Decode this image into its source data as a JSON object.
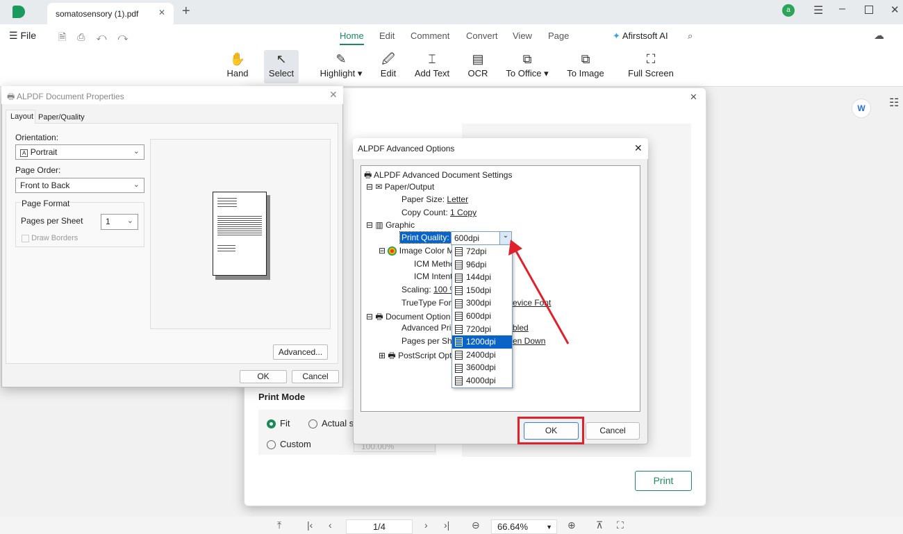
{
  "app": {
    "tab_title": "somatosensory (1).pdf",
    "user_initial": "a",
    "accent": "#1a8a5c"
  },
  "menu": {
    "file": "File",
    "tabs": [
      "Home",
      "Edit",
      "Comment",
      "Convert",
      "View",
      "Page"
    ],
    "ai": "Afirstsoft AI"
  },
  "toolbar": [
    {
      "label": "Hand",
      "icon": "hand-icon"
    },
    {
      "label": "Select",
      "icon": "cursor-icon"
    },
    {
      "label": "Highlight",
      "icon": "highlighter-icon"
    },
    {
      "label": "Edit",
      "icon": "edit-icon"
    },
    {
      "label": "Add Text",
      "icon": "add-text-icon"
    },
    {
      "label": "OCR",
      "icon": "ocr-icon"
    },
    {
      "label": "To Office",
      "icon": "office-icon"
    },
    {
      "label": "To Image",
      "icon": "image-icon"
    },
    {
      "label": "Full Screen",
      "icon": "fullscreen-icon"
    }
  ],
  "props": {
    "title": "ALPDF Document Properties",
    "tabs": [
      "Layout",
      "Paper/Quality"
    ],
    "orientation_label": "Orientation:",
    "orientation": "Portrait",
    "page_order_label": "Page Order:",
    "page_order": "Front to Back",
    "page_format": "Page Format",
    "pps_label": "Pages per Sheet",
    "pps": "1",
    "draw_borders": "Draw Borders",
    "advanced": "Advanced...",
    "ok": "OK",
    "cancel": "Cancel"
  },
  "adv": {
    "title": "ALPDF Advanced Options",
    "root": "ALPDF Advanced Document Settings",
    "paper_output": "Paper/Output",
    "paper_size_label": "Paper Size:",
    "paper_size": "Letter",
    "copy_count_label": "Copy Count:",
    "copy_count": "1 Copy",
    "graphic": "Graphic",
    "print_quality_label": "Print Quality:",
    "print_quality": "600dpi",
    "image_color": "Image Color M",
    "icm_method": "ICM Metho",
    "icm_intent": "ICM Intent",
    "scaling_label": "Scaling:",
    "scaling": "100 %",
    "truetype": "TrueType Font",
    "truetype_value": "evice Font",
    "doc_options": "Document Option",
    "adv_print": "Advanced Prin",
    "adv_print_value": "bled",
    "pps": "Pages per Shee",
    "pps_value": "en Down",
    "postscript": "PostScript Opt",
    "options": [
      "72dpi",
      "96dpi",
      "144dpi",
      "150dpi",
      "300dpi",
      "600dpi",
      "720dpi",
      "1200dpi",
      "2400dpi",
      "3600dpi",
      "4000dpi"
    ],
    "highlighted": "1200dpi",
    "ok": "OK",
    "cancel": "Cancel",
    "highlight_color": "#e0202a"
  },
  "print": {
    "mode_title": "Print Mode",
    "fit": "Fit",
    "actual": "Actual si",
    "custom": "Custom",
    "custom_value": "100.00%",
    "print_btn": "Print"
  },
  "bottom": {
    "page": "1/4",
    "zoom": "66.64%"
  }
}
